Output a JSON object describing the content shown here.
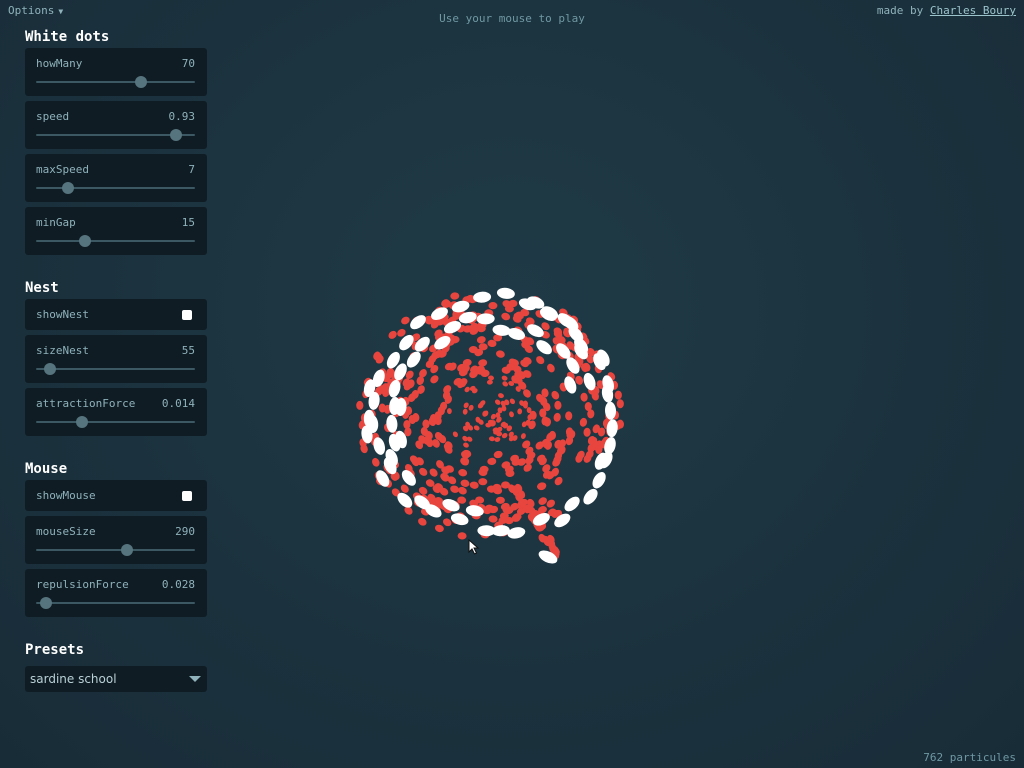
{
  "header": {
    "options_label": "Options",
    "hint": "Use your mouse to play",
    "credit_prefix": "made by",
    "credit_name": "Charles Boury"
  },
  "sections": [
    {
      "title": "White dots",
      "controls": [
        {
          "label": "howMany",
          "value": "70",
          "fraction": 0.66
        },
        {
          "label": "speed",
          "value": "0.93",
          "fraction": 0.88
        },
        {
          "label": "maxSpeed",
          "value": "7",
          "fraction": 0.2
        },
        {
          "label": "minGap",
          "value": "15",
          "fraction": 0.31
        }
      ]
    },
    {
      "title": "Nest",
      "showNest": {
        "label": "showNest",
        "checked": true
      },
      "controls": [
        {
          "label": "sizeNest",
          "value": "55",
          "fraction": 0.09
        },
        {
          "label": "attractionForce",
          "value": "0.014",
          "fraction": 0.29
        }
      ]
    },
    {
      "title": "Mouse",
      "showMouse": {
        "label": "showMouse",
        "checked": true
      },
      "controls": [
        {
          "label": "mouseSize",
          "value": "290",
          "fraction": 0.57
        },
        {
          "label": "repulsionForce",
          "value": "0.028",
          "fraction": 0.06
        }
      ]
    },
    {
      "title": "Presets",
      "preset": "sardine school"
    }
  ],
  "status": {
    "particle_count": "762 particules"
  },
  "colors": {
    "background": "#1c3440",
    "panel": "#0f1c24",
    "dot_white": "#ffffff",
    "dot_red": "#e8453f"
  }
}
